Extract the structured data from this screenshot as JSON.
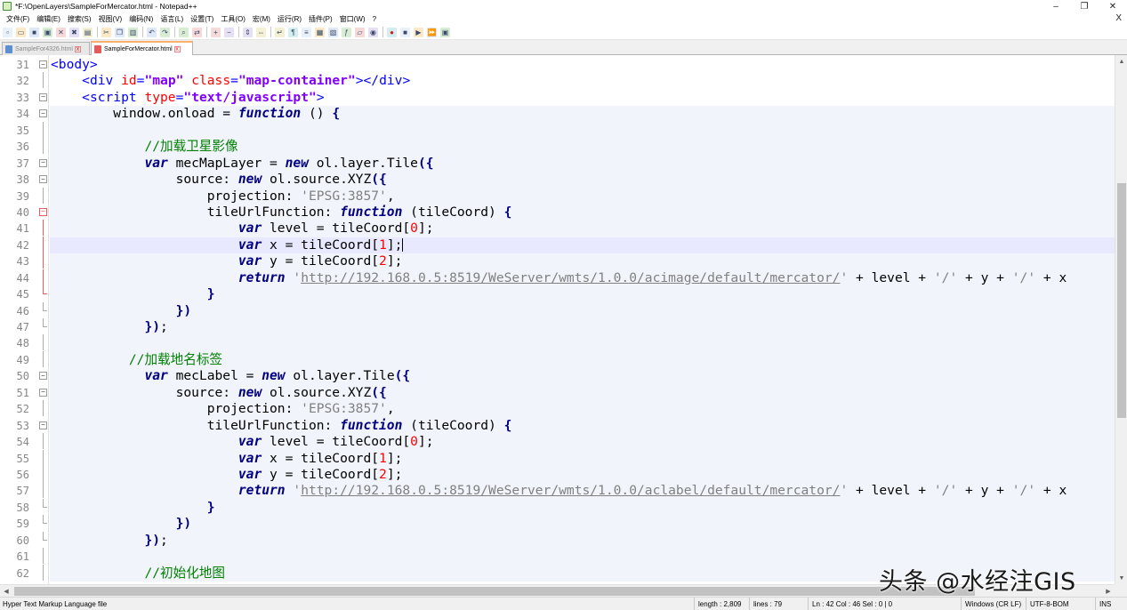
{
  "window": {
    "title": "*F:\\OpenLayers\\SampleForMercator.html - Notepad++",
    "controls": {
      "minimize": "–",
      "restore": "❐",
      "close": "✕"
    }
  },
  "menu": {
    "items": [
      "文件(F)",
      "编辑(E)",
      "搜索(S)",
      "视图(V)",
      "编码(N)",
      "语言(L)",
      "设置(T)",
      "工具(O)",
      "宏(M)",
      "运行(R)",
      "插件(P)",
      "窗口(W)",
      "?"
    ],
    "close_doc": "X"
  },
  "toolbar": {
    "groups": [
      [
        "new-file-icon",
        "open-file-icon",
        "save-icon",
        "save-all-icon",
        "close-icon",
        "close-all-icon",
        "print-icon"
      ],
      [
        "cut-icon",
        "copy-icon",
        "paste-icon"
      ],
      [
        "undo-icon",
        "redo-icon"
      ],
      [
        "find-icon",
        "replace-icon"
      ],
      [
        "zoom-in-icon",
        "zoom-out-icon"
      ],
      [
        "sync-vertical-icon",
        "sync-horizontal-icon"
      ],
      [
        "word-wrap-icon",
        "show-all-chars-icon",
        "indent-guide-icon",
        "udl-icon",
        "doc-map-icon",
        "function-list-icon",
        "folder-workspace-icon",
        "monitoring-icon"
      ],
      [
        "record-macro-icon",
        "stop-macro-icon",
        "play-macro-icon",
        "play-multiple-icon",
        "save-macro-icon"
      ]
    ]
  },
  "tabs": [
    {
      "label": "SampleFor4326.html",
      "active": false
    },
    {
      "label": "SampleForMercator.html",
      "active": true
    }
  ],
  "editor": {
    "current_line": 42,
    "lines": [
      {
        "n": 31,
        "fold": "box-minus",
        "bg": "none",
        "tokens": [
          [
            "tag",
            "<body>"
          ]
        ]
      },
      {
        "n": 32,
        "fold": "vline",
        "bg": "none",
        "tokens": [
          [
            "pl",
            "    "
          ],
          [
            "tag",
            "<div "
          ],
          [
            "attr",
            "id"
          ],
          [
            "tag",
            "="
          ],
          [
            "str",
            "\"map\""
          ],
          [
            "tag",
            " "
          ],
          [
            "attr",
            "class"
          ],
          [
            "tag",
            "="
          ],
          [
            "str",
            "\"map-container\""
          ],
          [
            "tag",
            "></div>"
          ]
        ]
      },
      {
        "n": 33,
        "fold": "box-minus",
        "bg": "none",
        "tokens": [
          [
            "pl",
            "    "
          ],
          [
            "tag",
            "<script "
          ],
          [
            "attr",
            "type"
          ],
          [
            "tag",
            "="
          ],
          [
            "str",
            "\"text/javascript\""
          ],
          [
            "tag",
            ">"
          ]
        ]
      },
      {
        "n": 34,
        "fold": "box-minus",
        "bg": "block",
        "tokens": [
          [
            "pl",
            "        window.onload = "
          ],
          [
            "kw",
            "function"
          ],
          [
            "pl",
            " () "
          ],
          [
            "pun",
            "{"
          ]
        ]
      },
      {
        "n": 35,
        "fold": "vline",
        "bg": "block",
        "tokens": []
      },
      {
        "n": 36,
        "fold": "vline",
        "bg": "block",
        "tokens": [
          [
            "pl",
            "            "
          ],
          [
            "cm",
            "//加载卫星影像"
          ]
        ]
      },
      {
        "n": 37,
        "fold": "box-minus",
        "bg": "block",
        "tokens": [
          [
            "pl",
            "            "
          ],
          [
            "kw",
            "var"
          ],
          [
            "pl",
            " mecMapLayer = "
          ],
          [
            "kw",
            "new"
          ],
          [
            "pl",
            " ol.layer.Tile"
          ],
          [
            "pun",
            "({"
          ]
        ]
      },
      {
        "n": 38,
        "fold": "box-minus",
        "bg": "block",
        "tokens": [
          [
            "pl",
            "                source: "
          ],
          [
            "kw",
            "new"
          ],
          [
            "pl",
            " ol.source.XYZ"
          ],
          [
            "pun",
            "({"
          ]
        ]
      },
      {
        "n": 39,
        "fold": "vline",
        "bg": "block",
        "tokens": [
          [
            "pl",
            "                    projection: "
          ],
          [
            "sq",
            "'EPSG:3857'"
          ],
          [
            "pl",
            ","
          ]
        ]
      },
      {
        "n": 40,
        "fold": "box-minus-red",
        "bg": "block",
        "tokens": [
          [
            "pl",
            "                    tileUrlFunction: "
          ],
          [
            "kw",
            "function"
          ],
          [
            "pl",
            " (tileCoord) "
          ],
          [
            "pun",
            "{"
          ]
        ]
      },
      {
        "n": 41,
        "fold": "vline-red",
        "bg": "block",
        "tokens": [
          [
            "pl",
            "                        "
          ],
          [
            "kw",
            "var"
          ],
          [
            "pl",
            " level = tileCoord["
          ],
          [
            "num",
            "0"
          ],
          [
            "pl",
            "];"
          ]
        ]
      },
      {
        "n": 42,
        "fold": "vline-red",
        "bg": "current",
        "tokens": [
          [
            "pl",
            "                        "
          ],
          [
            "kw",
            "var"
          ],
          [
            "pl",
            " x = tileCoord["
          ],
          [
            "num",
            "1"
          ],
          [
            "pl",
            "];"
          ],
          [
            "caret",
            ""
          ]
        ]
      },
      {
        "n": 43,
        "fold": "vline-red",
        "bg": "block",
        "tokens": [
          [
            "pl",
            "                        "
          ],
          [
            "kw",
            "var"
          ],
          [
            "pl",
            " y = tileCoord["
          ],
          [
            "num",
            "2"
          ],
          [
            "pl",
            "];"
          ]
        ]
      },
      {
        "n": 44,
        "fold": "vline-red",
        "bg": "block",
        "tokens": [
          [
            "pl",
            "                        "
          ],
          [
            "kw",
            "return"
          ],
          [
            "pl",
            " "
          ],
          [
            "sq",
            "'"
          ],
          [
            "url",
            "http://192.168.0.5:8519/WeServer/wmts/1.0.0/acimage/default/mercator/"
          ],
          [
            "sq",
            "'"
          ],
          [
            "pl",
            " + level + "
          ],
          [
            "sq",
            "'/'"
          ],
          [
            "pl",
            " + y + "
          ],
          [
            "sq",
            "'/'"
          ],
          [
            "pl",
            " + x"
          ]
        ]
      },
      {
        "n": 45,
        "fold": "corner-red",
        "bg": "block",
        "tokens": [
          [
            "pl",
            "                    "
          ],
          [
            "pun",
            "}"
          ]
        ]
      },
      {
        "n": 46,
        "fold": "corner",
        "bg": "block",
        "tokens": [
          [
            "pl",
            "                "
          ],
          [
            "pun",
            "})"
          ]
        ]
      },
      {
        "n": 47,
        "fold": "corner",
        "bg": "block",
        "tokens": [
          [
            "pl",
            "            "
          ],
          [
            "pun",
            "})"
          ],
          [
            "pl",
            ";"
          ]
        ]
      },
      {
        "n": 48,
        "fold": "vline",
        "bg": "block",
        "tokens": []
      },
      {
        "n": 49,
        "fold": "vline",
        "bg": "block",
        "tokens": [
          [
            "pl",
            "          "
          ],
          [
            "cm",
            "//加载地名标签"
          ]
        ]
      },
      {
        "n": 50,
        "fold": "box-minus",
        "bg": "block",
        "tokens": [
          [
            "pl",
            "            "
          ],
          [
            "kw",
            "var"
          ],
          [
            "pl",
            " mecLabel = "
          ],
          [
            "kw",
            "new"
          ],
          [
            "pl",
            " ol.layer.Tile"
          ],
          [
            "pun",
            "({"
          ]
        ]
      },
      {
        "n": 51,
        "fold": "box-minus",
        "bg": "block",
        "tokens": [
          [
            "pl",
            "                source: "
          ],
          [
            "kw",
            "new"
          ],
          [
            "pl",
            " ol.source.XYZ"
          ],
          [
            "pun",
            "({"
          ]
        ]
      },
      {
        "n": 52,
        "fold": "vline",
        "bg": "block",
        "tokens": [
          [
            "pl",
            "                    projection: "
          ],
          [
            "sq",
            "'EPSG:3857'"
          ],
          [
            "pl",
            ","
          ]
        ]
      },
      {
        "n": 53,
        "fold": "box-minus",
        "bg": "block",
        "tokens": [
          [
            "pl",
            "                    tileUrlFunction: "
          ],
          [
            "kw",
            "function"
          ],
          [
            "pl",
            " (tileCoord) "
          ],
          [
            "pun",
            "{"
          ]
        ]
      },
      {
        "n": 54,
        "fold": "vline",
        "bg": "block",
        "tokens": [
          [
            "pl",
            "                        "
          ],
          [
            "kw",
            "var"
          ],
          [
            "pl",
            " level = tileCoord["
          ],
          [
            "num",
            "0"
          ],
          [
            "pl",
            "];"
          ]
        ]
      },
      {
        "n": 55,
        "fold": "vline",
        "bg": "block",
        "tokens": [
          [
            "pl",
            "                        "
          ],
          [
            "kw",
            "var"
          ],
          [
            "pl",
            " x = tileCoord["
          ],
          [
            "num",
            "1"
          ],
          [
            "pl",
            "];"
          ]
        ]
      },
      {
        "n": 56,
        "fold": "vline",
        "bg": "block",
        "tokens": [
          [
            "pl",
            "                        "
          ],
          [
            "kw",
            "var"
          ],
          [
            "pl",
            " y = tileCoord["
          ],
          [
            "num",
            "2"
          ],
          [
            "pl",
            "];"
          ]
        ]
      },
      {
        "n": 57,
        "fold": "vline",
        "bg": "block",
        "tokens": [
          [
            "pl",
            "                        "
          ],
          [
            "kw",
            "return"
          ],
          [
            "pl",
            " "
          ],
          [
            "sq",
            "'"
          ],
          [
            "url",
            "http://192.168.0.5:8519/WeServer/wmts/1.0.0/aclabel/default/mercator/"
          ],
          [
            "sq",
            "'"
          ],
          [
            "pl",
            " + level + "
          ],
          [
            "sq",
            "'/'"
          ],
          [
            "pl",
            " + y + "
          ],
          [
            "sq",
            "'/'"
          ],
          [
            "pl",
            " + x"
          ]
        ]
      },
      {
        "n": 58,
        "fold": "corner",
        "bg": "block",
        "tokens": [
          [
            "pl",
            "                    "
          ],
          [
            "pun",
            "}"
          ]
        ]
      },
      {
        "n": 59,
        "fold": "corner",
        "bg": "block",
        "tokens": [
          [
            "pl",
            "                "
          ],
          [
            "pun",
            "})"
          ]
        ]
      },
      {
        "n": 60,
        "fold": "corner",
        "bg": "block",
        "tokens": [
          [
            "pl",
            "            "
          ],
          [
            "pun",
            "})"
          ],
          [
            "pl",
            ";"
          ]
        ]
      },
      {
        "n": 61,
        "fold": "vline",
        "bg": "block",
        "tokens": []
      },
      {
        "n": 62,
        "fold": "vline",
        "bg": "block",
        "tokens": [
          [
            "pl",
            "            "
          ],
          [
            "cm",
            "//初始化地图"
          ]
        ]
      }
    ]
  },
  "scrollbars": {
    "vertical_position": 0.43,
    "horizontal_position": 0.0
  },
  "status": {
    "file_type": "Hyper Text Markup Language file",
    "length": "length : 2,809",
    "lines": "lines : 79",
    "position": "Ln : 42    Col : 46    Sel : 0 | 0",
    "eol": "Windows (CR LF)",
    "encoding": "UTF-8-BOM",
    "mode": "INS"
  },
  "watermark": "头条 @水经注GIS",
  "colors": {
    "tag": "#0000ff",
    "attribute": "#ff0000",
    "attr_value": "#8000ff",
    "keyword": "#000080",
    "comment": "#008000",
    "string": "#808080",
    "number": "#ff0000",
    "block_bg": "#f1f4fb",
    "current_line_bg": "#e8e8ff",
    "active_tab_accent": "#f9b06a"
  }
}
